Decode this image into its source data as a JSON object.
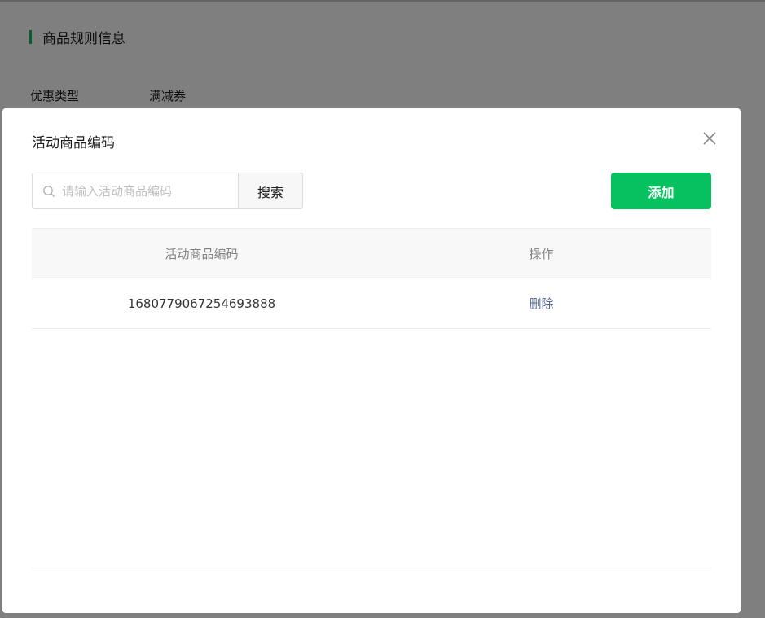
{
  "background": {
    "section_title": "商品规则信息",
    "fields": [
      {
        "label": "优惠类型",
        "value": "满减券"
      }
    ]
  },
  "dialog": {
    "title": "活动商品编码",
    "search": {
      "placeholder": "请输入活动商品编码",
      "value": "",
      "button_label": "搜索"
    },
    "add_label": "添加",
    "table": {
      "columns": [
        "活动商品编码",
        "操作"
      ],
      "rows": [
        {
          "code": "1680779067254693888",
          "action": "删除"
        }
      ]
    }
  },
  "colors": {
    "accent": "#07c160",
    "link": "#576b95"
  },
  "icons": [
    "search-icon",
    "close-icon"
  ]
}
